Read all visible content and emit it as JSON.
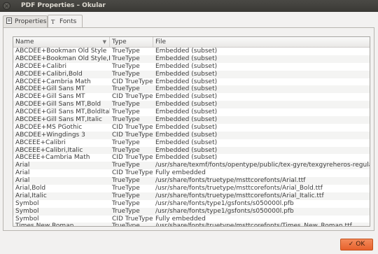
{
  "window": {
    "title": "PDF Properties – Okular"
  },
  "tabs": [
    {
      "label": "Properties",
      "active": false
    },
    {
      "label": "Fonts",
      "active": true
    }
  ],
  "table": {
    "columns": [
      "Name",
      "Type",
      "File"
    ],
    "rows": [
      [
        "ABCDEE+Bookman Old Style",
        "TrueType",
        "Embedded (subset)"
      ],
      [
        "ABCDEE+Bookman Old Style,Bold",
        "TrueType",
        "Embedded (subset)"
      ],
      [
        "ABCDEE+Calibri",
        "TrueType",
        "Embedded (subset)"
      ],
      [
        "ABCDEE+Calibri,Bold",
        "TrueType",
        "Embedded (subset)"
      ],
      [
        "ABCDEE+Cambria Math",
        "CID TrueType",
        "Embedded (subset)"
      ],
      [
        "ABCDEE+Gill Sans MT",
        "TrueType",
        "Embedded (subset)"
      ],
      [
        "ABCDEE+Gill Sans MT",
        "CID TrueType",
        "Embedded (subset)"
      ],
      [
        "ABCDEE+Gill Sans MT,Bold",
        "TrueType",
        "Embedded (subset)"
      ],
      [
        "ABCDEE+Gill Sans MT,BoldItalic",
        "TrueType",
        "Embedded (subset)"
      ],
      [
        "ABCDEE+Gill Sans MT,Italic",
        "TrueType",
        "Embedded (subset)"
      ],
      [
        "ABCDEE+MS PGothic",
        "CID TrueType",
        "Embedded (subset)"
      ],
      [
        "ABCDEE+Wingdings 3",
        "CID TrueType",
        "Embedded (subset)"
      ],
      [
        "ABCEEE+Calibri",
        "TrueType",
        "Embedded (subset)"
      ],
      [
        "ABCEEE+Calibri,Italic",
        "TrueType",
        "Embedded (subset)"
      ],
      [
        "ABCEEE+Cambria Math",
        "CID TrueType",
        "Embedded (subset)"
      ],
      [
        "Arial",
        "TrueType",
        "/usr/share/texmf/fonts/opentype/public/tex-gyre/texgyreheros-regular.otf"
      ],
      [
        "Arial",
        "CID TrueType",
        "Fully embedded"
      ],
      [
        "Arial",
        "TrueType",
        "/usr/share/fonts/truetype/msttcorefonts/Arial.ttf"
      ],
      [
        "Arial,Bold",
        "TrueType",
        "/usr/share/fonts/truetype/msttcorefonts/Arial_Bold.ttf"
      ],
      [
        "Arial,Italic",
        "TrueType",
        "/usr/share/fonts/truetype/msttcorefonts/Arial_Italic.ttf"
      ],
      [
        "Symbol",
        "TrueType",
        "/usr/share/fonts/type1/gsfonts/s050000l.pfb"
      ],
      [
        "Symbol",
        "TrueType",
        "/usr/share/fonts/type1/gsfonts/s050000l.pfb"
      ],
      [
        "Symbol",
        "CID TrueType",
        "Fully embedded"
      ],
      [
        "Times New Roman",
        "TrueType",
        "/usr/share/fonts/truetype/msttcorefonts/Times_New_Roman.ttf"
      ]
    ]
  },
  "buttons": {
    "ok_label": "OK"
  },
  "icons": {
    "close": "close-icon",
    "properties_tab": "document-icon",
    "fonts_tab": "font-icon",
    "ok": "check-icon",
    "sort": "sort-down-icon"
  }
}
